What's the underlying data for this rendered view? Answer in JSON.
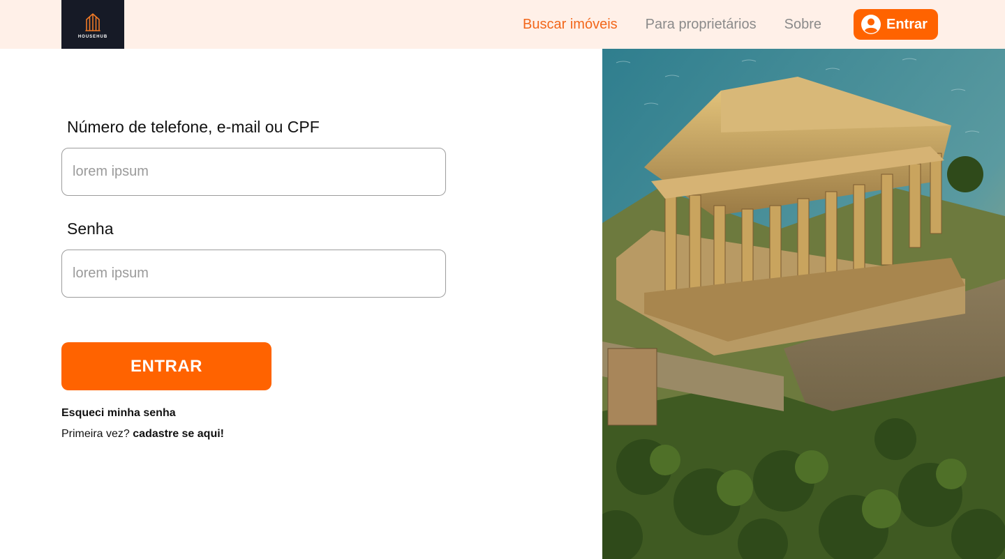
{
  "brand": {
    "name": "HOUSEHUB"
  },
  "nav": {
    "links": [
      {
        "label": "Buscar imóveis",
        "active": true
      },
      {
        "label": "Para proprietários",
        "active": false
      },
      {
        "label": "Sobre",
        "active": false
      }
    ],
    "login_label": "Entrar",
    "login_icon": "user-circle-icon"
  },
  "form": {
    "identifier_label": "Número de telefone, e-mail ou CPF",
    "identifier_placeholder": "lorem ipsum",
    "password_label": "Senha",
    "password_placeholder": "lorem ipsum",
    "submit_label": "ENTRAR",
    "forgot_label": "Esqueci minha senha",
    "first_time_text": "Primeira vez?",
    "signup_label": "cadastre se aqui!"
  },
  "hero": {
    "image": "Parthenon ruins on cliff above sea"
  },
  "colors": {
    "accent": "#ff6300",
    "header_bg": "#fff0e8",
    "logo_bg": "#161a26",
    "nav_inactive": "#8a8a8a"
  }
}
